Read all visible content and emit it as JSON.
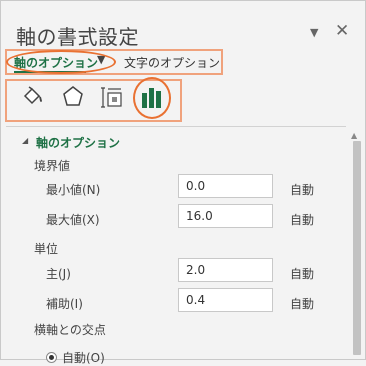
{
  "panel": {
    "title": "軸の書式設定",
    "menu_glyph": "▼",
    "close_glyph": "✕"
  },
  "option_tabs": {
    "axis_options": "軸のオプション",
    "dropdown_glyph": "▼",
    "text_options": "文字のオプション"
  },
  "icon_tabs": [
    "fill-line-icon",
    "effects-icon",
    "size-properties-icon",
    "axis-options-icon"
  ],
  "accent_color": "#1e7145",
  "highlight_color": "#e97132",
  "section": {
    "expand_glyph": "◢",
    "title": "軸のオプション",
    "bounds_label": "境界値",
    "min_label": "最小値(N)",
    "min_value": "0.0",
    "max_label": "最大値(X)",
    "max_value": "16.0",
    "auto_label": "自動",
    "units_label": "単位",
    "major_label": "主(J)",
    "major_value": "2.0",
    "minor_label": "補助(I)",
    "minor_value": "0.4",
    "cross_label": "横軸との交点",
    "radio_auto": "自動(O)"
  }
}
